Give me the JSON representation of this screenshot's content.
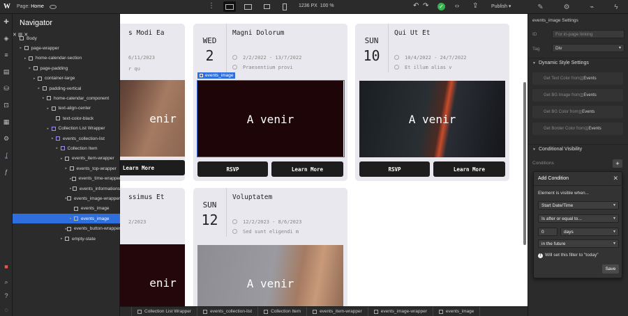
{
  "topbar": {
    "logo": "W",
    "page_prefix": "Page:",
    "page_name": "Home",
    "size": "1236 PX",
    "zoom": "100 %",
    "publish": "Publish ▾"
  },
  "navigator": {
    "title": "Navigator",
    "items": [
      {
        "label": "Body"
      },
      {
        "label": "page-wrapper"
      },
      {
        "label": "home-calendar-section"
      },
      {
        "label": "page-padding"
      },
      {
        "label": "container-large"
      },
      {
        "label": "padding-vertical"
      },
      {
        "label": "home-calendar_component"
      },
      {
        "label": "text-align-center"
      },
      {
        "label": "text-color-black"
      },
      {
        "label": "Collection List Wrapper"
      },
      {
        "label": "events_collection-list"
      },
      {
        "label": "Collection Item"
      },
      {
        "label": "events_item-wrapper"
      },
      {
        "label": "events_top-wrapper"
      },
      {
        "label": "events_time-wrapper"
      },
      {
        "label": "events_informations"
      },
      {
        "label": "events_image-wrapper"
      },
      {
        "label": "events_image"
      },
      {
        "label": "events_image"
      },
      {
        "label": "events_button-wrapper"
      },
      {
        "label": "empty-state"
      }
    ]
  },
  "cards": [
    {
      "dow": "",
      "day": "",
      "title": "s Modi Ea",
      "dates": "6/11/2023",
      "place": "r qu",
      "image_text": "enir",
      "buttons": [
        "",
        "Learn More"
      ]
    },
    {
      "dow": "WED",
      "day": "2",
      "title": "Magni Dolorum",
      "dates": "2/2/2022 - 13/7/2022",
      "place": "Praesentium provi",
      "image_text": "A venir",
      "buttons": [
        "RSVP",
        "Learn More"
      ]
    },
    {
      "dow": "SUN",
      "day": "10",
      "title": "Qui Ut Et",
      "dates": "10/4/2022 - 24/7/2022",
      "place": "Et illum alias v",
      "image_text": "A venir",
      "buttons": [
        "RSVP",
        "Learn More"
      ]
    },
    {
      "dow": "",
      "day": "",
      "title": "ssimus Et",
      "dates": "2/2023",
      "place": "",
      "image_text": "enir",
      "buttons": []
    },
    {
      "dow": "SUN",
      "day": "12",
      "title": "Voluptatem",
      "dates": "12/2/2023 - 8/6/2023",
      "place": "Sed sunt eligendi m",
      "image_text": "A venir",
      "buttons": []
    }
  ],
  "selection_tag": "events_image",
  "breadcrumbs": [
    "",
    "Collection List Wrapper",
    "events_collection-list",
    "Collection Item",
    "events_item-wrapper",
    "events_image-wrapper",
    "events_image"
  ],
  "right_panel": {
    "settings_header": "events_image Settings",
    "id_label": "ID",
    "id_placeholder": "For in-page linking",
    "tag_label": "Tag",
    "tag_value": "Div",
    "dynamic_title": "Dynamic Style Settings",
    "dynamic_items": [
      {
        "label": "Get Text Color from",
        "source": "Events"
      },
      {
        "label": "Get BG Image from",
        "source": "Events"
      },
      {
        "label": "Get BG Color from",
        "source": "Events"
      },
      {
        "label": "Get Border Color from",
        "source": "Events"
      }
    ],
    "visibility_title": "Conditional Visibility",
    "conditions_label": "Conditions",
    "plus": "+"
  },
  "popup": {
    "title": "Add Condition",
    "close": "✕",
    "visible_when": "Element is visible when...",
    "field": "Start Date/Time",
    "operator": "Is after or equal to...",
    "number": "0",
    "unit": "days",
    "direction": "in the future",
    "info": "Will set this filter to \"today\"",
    "save": "Save"
  }
}
